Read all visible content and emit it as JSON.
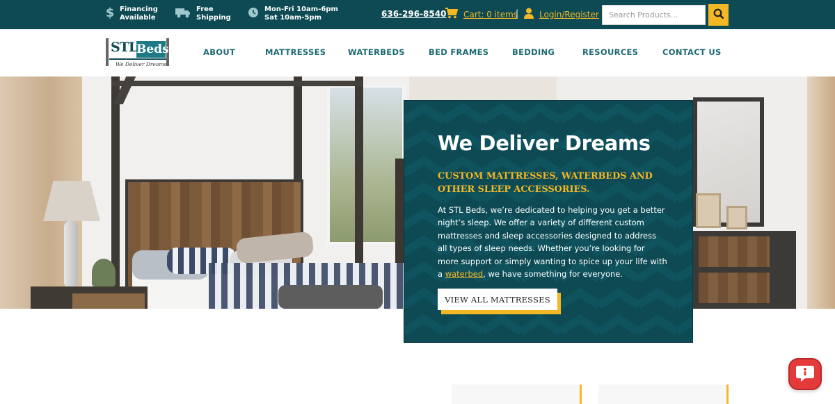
{
  "topbar": {
    "financing": [
      "Financing",
      "Available"
    ],
    "shipping": [
      "Free",
      "Shipping"
    ],
    "hours": [
      "Mon-Fri 10am-6pm",
      "Sat 10am-5pm"
    ],
    "phone": "636-296-8540",
    "cart_label": "Cart: 0 items",
    "separator": "|",
    "login_label": "Login/Register",
    "search_placeholder": "Search Products...",
    "icons": {
      "financing": "dollar-icon",
      "shipping": "truck-icon",
      "hours": "clock-icon",
      "cart": "cart-icon",
      "login": "user-icon",
      "search": "search-icon"
    }
  },
  "logo": {
    "stl": "STL",
    "beds": "Beds",
    "tagline": "We Deliver Dreams"
  },
  "nav": {
    "items": [
      "ABOUT",
      "MATTRESSES",
      "WATERBEDS",
      "BED FRAMES",
      "BEDDING",
      "RESOURCES",
      "CONTACT US"
    ]
  },
  "hero": {
    "title": "We Deliver Dreams",
    "subtitle": "CUSTOM MATTRESSES, WATERBEDS AND OTHER SLEEP ACCESSORIES.",
    "body_before": "At STL Beds, we’re dedicated to helping you get a better night’s sleep. We offer a variety of different custom mattresses and sleep accessories designed to address all types of sleep needs. Whether you’re looking for more support or simply wanting to spice up your life with a ",
    "body_link": "waterbed",
    "body_after": ", we have something for everyone.",
    "cta_label": "VIEW ALL MATTRESSES"
  },
  "chat": {
    "icon": "chat-icon"
  },
  "colors": {
    "brand_teal": "#0d4a54",
    "accent_gold": "#f5b825",
    "nav_text": "#1e6a72",
    "chat_red": "#e53a3a"
  }
}
